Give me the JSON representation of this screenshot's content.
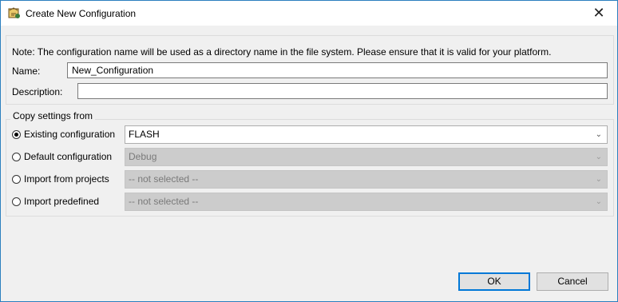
{
  "window": {
    "title": "Create New Configuration"
  },
  "note": "Note: The configuration name will be used as a directory name in the file system.  Please ensure that it is valid for your platform.",
  "name_label": "Name:",
  "name_value": "New_Configuration",
  "description_label": "Description:",
  "description_value": "",
  "copy_group": {
    "legend": "Copy settings from",
    "options": [
      {
        "label": "Existing configuration",
        "selected": true,
        "combo_value": "FLASH",
        "enabled": true
      },
      {
        "label": "Default configuration",
        "selected": false,
        "combo_value": "Debug",
        "enabled": false
      },
      {
        "label": "Import from projects",
        "selected": false,
        "combo_value": "-- not selected --",
        "enabled": false
      },
      {
        "label": "Import predefined",
        "selected": false,
        "combo_value": "-- not selected --",
        "enabled": false
      }
    ]
  },
  "buttons": {
    "ok": "OK",
    "cancel": "Cancel"
  },
  "icons": {
    "app": "cdt-config-icon",
    "close": "close-icon",
    "dropdown": "chevron-down-icon"
  }
}
